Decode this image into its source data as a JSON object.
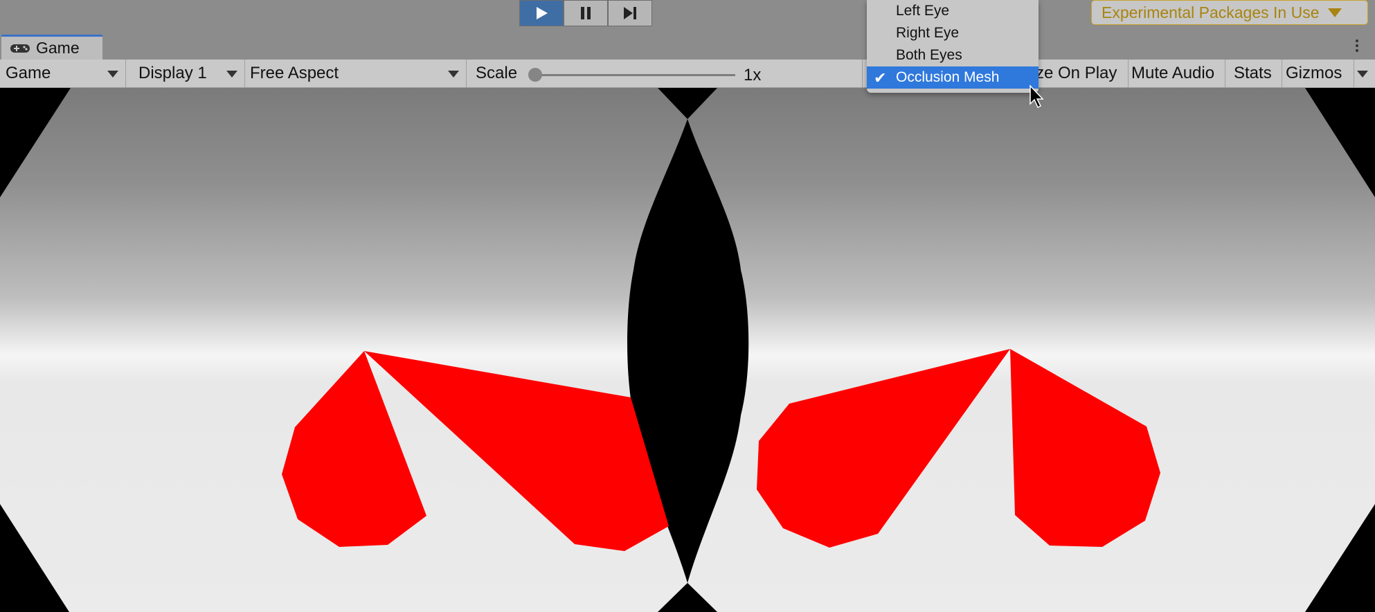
{
  "toolbar_top": {
    "play_icon": "play-icon",
    "pause_icon": "pause-icon",
    "step_icon": "step-icon",
    "experimental": "Experimental Packages In Use"
  },
  "tab": {
    "label": "Game",
    "icon": "gamepad-icon"
  },
  "game_toolbar": {
    "mode": "Game",
    "display": "Display 1",
    "aspect": "Free Aspect",
    "scale_label": "Scale",
    "scale_value": "1x",
    "maximize": "ze On Play",
    "mute": "Mute Audio",
    "stats": "Stats",
    "gizmos": "Gizmos"
  },
  "menu": {
    "items": [
      {
        "label": "Left Eye",
        "checked": false
      },
      {
        "label": "Right Eye",
        "checked": false
      },
      {
        "label": "Both Eyes",
        "checked": false
      },
      {
        "label": "Occlusion Mesh",
        "checked": true
      }
    ],
    "check_glyph": "✔"
  },
  "colors": {
    "accent": "#2f78dc",
    "play_active": "#3f6ea5",
    "warning": "#a88410",
    "shape": "#ff0000",
    "mask": "#000000"
  }
}
